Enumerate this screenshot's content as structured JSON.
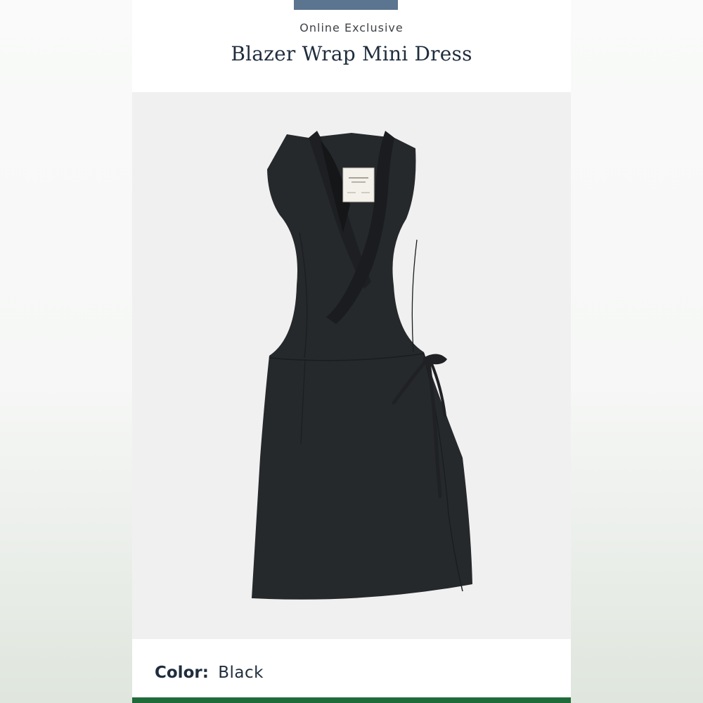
{
  "product": {
    "badge": "Online Exclusive",
    "name": "Blazer Wrap Mini Dress",
    "image_alt": "dress-product-image",
    "color_label": "Color:",
    "color_value": "Black"
  },
  "colors": {
    "accent_tab": "#5b7490",
    "title": "#1f2d3d",
    "image_bg": "#f0f0f0",
    "dress": "#26292c",
    "bottom_bar": "#1f6b3a"
  }
}
